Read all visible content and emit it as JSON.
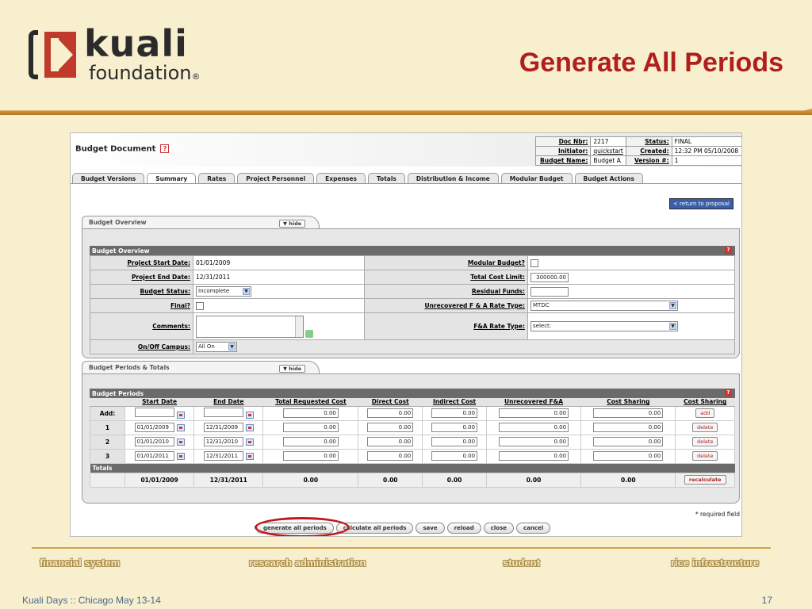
{
  "slide": {
    "logo_word1": "kuali",
    "logo_word2": "foundation",
    "logo_mark": "®",
    "title": "Generate All Periods",
    "footer_nav": [
      "financial system",
      "research administration",
      "student",
      "rice infrastructure"
    ],
    "footer_left": "Kuali Days :: Chicago May 13-14",
    "page_number": "17"
  },
  "document": {
    "title": "Budget Document",
    "help": "?",
    "info": {
      "doc_nbr_label": "Doc Nbr:",
      "doc_nbr": "2217",
      "status_label": "Status:",
      "status": "FINAL",
      "initiator_label": "Initiator:",
      "initiator": "quickstart",
      "created_label": "Created:",
      "created": "12:32 PM 05/10/2008",
      "budget_name_label": "Budget Name:",
      "budget_name": "Budget A",
      "version_label": "Version #:",
      "version": "1"
    }
  },
  "tabs": [
    "Budget Versions",
    "Summary",
    "Rates",
    "Project Personnel",
    "Expenses",
    "Totals",
    "Distribution & Income",
    "Modular Budget",
    "Budget Actions"
  ],
  "return_button": "< return to proposal",
  "overview": {
    "panel_tab": "Budget Overview",
    "hide": "▼ hide",
    "section_title": "Budget Overview",
    "project_start_label": "Project Start Date:",
    "project_start": "01/01/2009",
    "project_end_label": "Project End Date:",
    "project_end": "12/31/2011",
    "budget_status_label": "Budget Status:",
    "budget_status": "Incomplete",
    "final_label": "Final?",
    "comments_label": "Comments:",
    "campus_label": "On/Off Campus:",
    "campus": "All On",
    "modular_label": "Modular Budget?",
    "total_cost_limit_label": "Total Cost Limit:",
    "total_cost_limit": "300000.00",
    "residual_label": "Residual Funds:",
    "residual": "",
    "unrecovered_fa_label": "Unrecovered F & A Rate Type:",
    "unrecovered_fa": "MTDC",
    "fa_rate_label": "F&A Rate Type:",
    "fa_rate": "select:"
  },
  "periods": {
    "panel_tab": "Budget Periods & Totals",
    "hide": "▼ hide",
    "section_title": "Budget Periods",
    "columns": [
      "Start Date",
      "End Date",
      "Total Requested Cost",
      "Direct Cost",
      "Indirect Cost",
      "Unrecovered F&A",
      "Cost Sharing",
      "Cost Sharing"
    ],
    "add_label": "Add:",
    "add_button": "add",
    "add_values": [
      "0.00",
      "0.00",
      "0.00",
      "0.00",
      "0.00"
    ],
    "rows": [
      {
        "n": "1",
        "start": "01/01/2009",
        "end": "12/31/2009",
        "total": "0.00",
        "direct": "0.00",
        "indirect": "0.00",
        "unrec": "0.00",
        "share": "0.00",
        "action": "delete"
      },
      {
        "n": "2",
        "start": "01/01/2010",
        "end": "12/31/2010",
        "total": "0.00",
        "direct": "0.00",
        "indirect": "0.00",
        "unrec": "0.00",
        "share": "0.00",
        "action": "delete"
      },
      {
        "n": "3",
        "start": "01/01/2011",
        "end": "12/31/2011",
        "total": "0.00",
        "direct": "0.00",
        "indirect": "0.00",
        "unrec": "0.00",
        "share": "0.00",
        "action": "delete"
      }
    ],
    "totals_label": "Totals",
    "totals": {
      "start": "01/01/2009",
      "end": "12/31/2011",
      "total": "0.00",
      "direct": "0.00",
      "indirect": "0.00",
      "unrec": "0.00",
      "share": "0.00"
    },
    "recalc_button": "recalculate"
  },
  "required_note": "* required field",
  "actions": [
    "generate all periods",
    "calculate all periods",
    "save",
    "reload",
    "close",
    "cancel"
  ]
}
